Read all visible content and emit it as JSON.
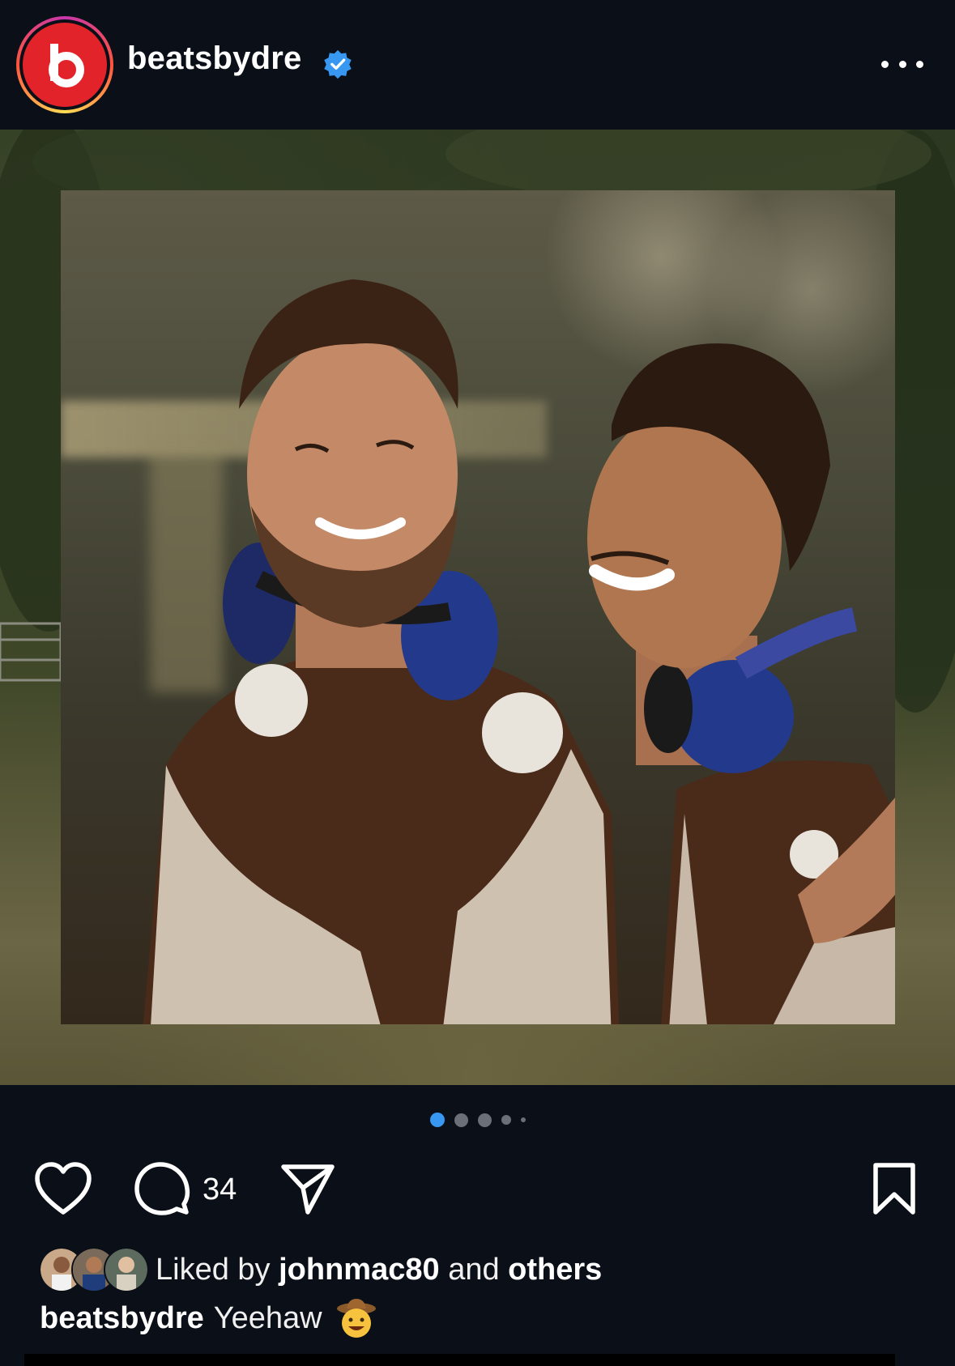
{
  "header": {
    "username": "beatsbydre",
    "verified_icon": "verified-badge-icon",
    "more_icon": "more-options-icon",
    "avatar_logo": "b"
  },
  "post": {
    "carousel": {
      "total": 5,
      "active_index": 0
    },
    "actions": {
      "like_icon": "heart-icon",
      "comment_icon": "comment-icon",
      "comment_count": "34",
      "share_icon": "send-icon",
      "save_icon": "bookmark-icon"
    },
    "likes": {
      "prefix": "Liked by",
      "user": "johnmac80",
      "connector": "and",
      "others": "others"
    },
    "caption": {
      "username": "beatsbydre",
      "text": "Yeehaw",
      "emoji": "cowboy-face-emoji"
    }
  },
  "colors": {
    "background": "#0b0f17",
    "accent_blue": "#3897f0",
    "verified_blue": "#3897f0",
    "beats_red": "#e2232a"
  }
}
